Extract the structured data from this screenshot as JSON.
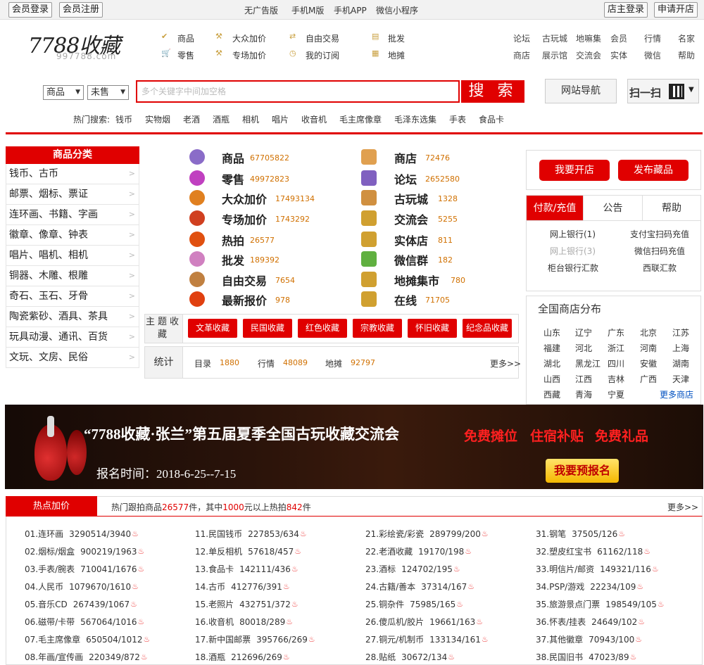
{
  "topbar": {
    "login": "会员登录",
    "register": "会员注册",
    "links": [
      "无广告版",
      "手机M版",
      "手机APP",
      "微信小程序"
    ],
    "shop_login": "店主登录",
    "open_shop": "申请开店"
  },
  "logo": {
    "main": "7788收藏",
    "sub": "997788.com"
  },
  "nav": {
    "col1": [
      "商品",
      "零售"
    ],
    "col2": [
      "大众加价",
      "专场加价"
    ],
    "col3": [
      "自由交易",
      "我的订阅"
    ],
    "col4": [
      "批发",
      "地摊"
    ]
  },
  "right_links": {
    "row1": [
      "论坛",
      "古玩城",
      "地嘛集",
      "会员",
      "行情",
      "名家"
    ],
    "row2": [
      "商店",
      "展示馆",
      "交流会",
      "实体",
      "微信",
      "帮助"
    ]
  },
  "search": {
    "type_select": "商品",
    "status_select": "未售",
    "placeholder": "多个关键字中间加空格",
    "button": "搜 索",
    "site_nav": "网站导航",
    "scan": "扫一扫"
  },
  "hot_search": {
    "label": "热门搜索:",
    "items": [
      "钱币",
      "实物烟",
      "老酒",
      "酒瓶",
      "相机",
      "唱片",
      "收音机",
      "毛主席像章",
      "毛泽东选集",
      "手表",
      "食品卡"
    ]
  },
  "category": {
    "title": "商品分类",
    "items": [
      "钱币、古币",
      "邮票、烟标、票证",
      "连环画、书籍、字画",
      "徽章、像章、钟表",
      "唱片、唱机、相机",
      "铜器、木雕、根雕",
      "奇石、玉石、牙骨",
      "陶瓷紫砂、酒具、茶具",
      "玩具动漫、通讯、百货",
      "文玩、文房、民俗"
    ]
  },
  "stats_left": [
    {
      "label": "商品",
      "value": "67705822",
      "icon": "grapes-icon"
    },
    {
      "label": "零售",
      "value": "49972823",
      "icon": "cart-icon"
    },
    {
      "label": "大众加价",
      "value": "17493134",
      "icon": "hammer-icon"
    },
    {
      "label": "专场加价",
      "value": "1743292",
      "icon": "gavel-icon"
    },
    {
      "label": "热拍",
      "value": "26577",
      "icon": "fire-icon"
    },
    {
      "label": "批发",
      "value": "189392",
      "icon": "box-icon"
    },
    {
      "label": "自由交易",
      "value": "7654",
      "icon": "handshake-icon"
    },
    {
      "label": "最新报价",
      "value": "978",
      "icon": "flame-icon"
    }
  ],
  "stats_right": [
    {
      "label": "商店",
      "value": "72476",
      "icon": "shop-icon"
    },
    {
      "label": "论坛",
      "value": "2652580",
      "icon": "forum-icon"
    },
    {
      "label": "古玩城",
      "value": "1328",
      "icon": "market-icon"
    },
    {
      "label": "交流会",
      "value": "5255",
      "icon": "globe-icon"
    },
    {
      "label": "实体店",
      "value": "811",
      "icon": "store-icon"
    },
    {
      "label": "微信群",
      "value": "182",
      "icon": "wechat-icon"
    },
    {
      "label": "地摊集市",
      "value": "780",
      "icon": "list-icon"
    },
    {
      "label": "在线",
      "value": "71705",
      "icon": "users-icon"
    }
  ],
  "theme": {
    "label": "主题收藏",
    "buttons": [
      "文革收藏",
      "民国收藏",
      "红色收藏",
      "宗教收藏",
      "怀旧收藏",
      "纪念品收藏"
    ]
  },
  "statistics": {
    "label": "统计",
    "items": [
      {
        "label": "目录",
        "value": "1880"
      },
      {
        "label": "行情",
        "value": "48089"
      },
      {
        "label": "地摊",
        "value": "92797"
      }
    ],
    "more": "更多>>"
  },
  "right_panel": {
    "open_shop": "我要开店",
    "publish": "发布藏品",
    "tabs": [
      "付款/充值",
      "公告",
      "帮助"
    ],
    "pay_links": [
      "网上银行(1)",
      "支付宝扫码充值",
      "网上银行(3)",
      "微信扫码充值",
      "柜台银行汇款",
      "西联汇款"
    ],
    "dist_title": "全国商店分布",
    "provinces": [
      "山东",
      "辽宁",
      "广东",
      "北京",
      "江苏",
      "福建",
      "河北",
      "浙江",
      "河南",
      "上海",
      "湖北",
      "黑龙江",
      "四川",
      "安徽",
      "湖南",
      "山西",
      "江西",
      "吉林",
      "广西",
      "天津",
      "西藏",
      "青海",
      "宁夏"
    ],
    "more_shops": "更多商店"
  },
  "banner": {
    "title": "“7788收藏·张兰”第五届夏季全国古玩收藏交流会",
    "benefits": [
      "免费摊位",
      "住宿补贴",
      "免费礼品"
    ],
    "date": "报名时间：2018-6-25--7-15",
    "cta": "我要预报名"
  },
  "hot_bid": {
    "tab": "热点加价",
    "summary_pre": "热门跟拍商品",
    "summary_num1": "26577",
    "summary_mid": "件，其中",
    "summary_num2": "1000",
    "summary_mid2": "元以上热拍",
    "summary_num3": "842",
    "summary_post": "件",
    "more": "更多>>",
    "items": [
      [
        "01.连环画",
        "3290514/3940"
      ],
      [
        "02.烟标/烟盒",
        "900219/1963"
      ],
      [
        "03.手表/腕表",
        "710041/1676"
      ],
      [
        "04.人民币",
        "1079670/1610"
      ],
      [
        "05.音乐CD",
        "267439/1067"
      ],
      [
        "06.磁带/卡带",
        "567064/1016"
      ],
      [
        "07.毛主席像章",
        "650504/1012"
      ],
      [
        "08.年画/宣传画",
        "220349/872"
      ],
      [
        "11.民国钱币",
        "227853/634"
      ],
      [
        "12.单反相机",
        "57618/457"
      ],
      [
        "13.食品卡",
        "142111/436"
      ],
      [
        "14.古币",
        "412776/391"
      ],
      [
        "15.老照片",
        "432751/372"
      ],
      [
        "16.收音机",
        "80018/289"
      ],
      [
        "17.新中国邮票",
        "395766/269"
      ],
      [
        "18.酒瓶",
        "212696/269"
      ],
      [
        "21.彩绘瓷/彩瓷",
        "289799/200"
      ],
      [
        "22.老酒收藏",
        "19170/198"
      ],
      [
        "23.酒标",
        "124702/195"
      ],
      [
        "24.古籍/善本",
        "37314/167"
      ],
      [
        "25.铜杂件",
        "75985/165"
      ],
      [
        "26.傻瓜机/胶片",
        "19661/163"
      ],
      [
        "27.铜元/机制币",
        "133134/161"
      ],
      [
        "28.贴纸",
        "30672/134"
      ],
      [
        "31.钢笔",
        "37505/126"
      ],
      [
        "32.塑皮红宝书",
        "61162/118"
      ],
      [
        "33.明信片/邮资",
        "149321/116"
      ],
      [
        "34.PSP/游戏",
        "22234/109"
      ],
      [
        "35.旅游景点门票",
        "198549/105"
      ],
      [
        "36.怀表/挂表",
        "24649/102"
      ],
      [
        "37.其他徽章",
        "70943/100"
      ],
      [
        "38.民国旧书",
        "47023/89"
      ]
    ]
  }
}
